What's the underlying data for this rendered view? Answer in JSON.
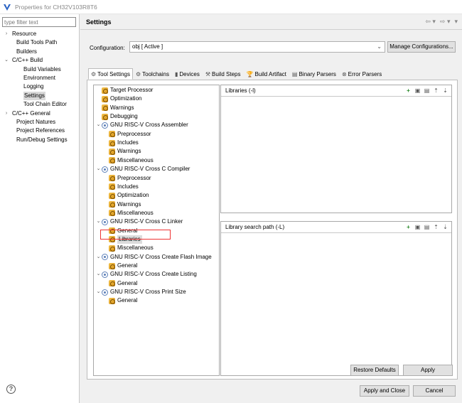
{
  "window": {
    "title": "Properties for CH32V103R8T6"
  },
  "filter": {
    "placeholder": "type filter text"
  },
  "nav": [
    {
      "label": "Resource",
      "indent": 0,
      "arrow": "›"
    },
    {
      "label": "Build Tools Path",
      "indent": 1,
      "arrow": ""
    },
    {
      "label": "Builders",
      "indent": 1,
      "arrow": ""
    },
    {
      "label": "C/C++ Build",
      "indent": 0,
      "arrow": "⌄"
    },
    {
      "label": "Build Variables",
      "indent": 2,
      "arrow": ""
    },
    {
      "label": "Environment",
      "indent": 2,
      "arrow": ""
    },
    {
      "label": "Logging",
      "indent": 2,
      "arrow": ""
    },
    {
      "label": "Settings",
      "indent": 2,
      "arrow": "",
      "selected": true
    },
    {
      "label": "Tool Chain Editor",
      "indent": 2,
      "arrow": ""
    },
    {
      "label": "C/C++ General",
      "indent": 0,
      "arrow": "›"
    },
    {
      "label": "Project Natures",
      "indent": 1,
      "arrow": ""
    },
    {
      "label": "Project References",
      "indent": 1,
      "arrow": ""
    },
    {
      "label": "Run/Debug Settings",
      "indent": 1,
      "arrow": ""
    }
  ],
  "page": {
    "title": "Settings"
  },
  "config": {
    "label": "Configuration:",
    "value": "obj  [ Active ]",
    "manage_label": "Manage Configurations..."
  },
  "tabs": [
    {
      "label": "Tool Settings",
      "icon": "tool-settings-icon",
      "glyph": "⚙",
      "active": true
    },
    {
      "label": "Toolchains",
      "icon": "toolchains-icon",
      "glyph": "⚙"
    },
    {
      "label": "Devices",
      "icon": "devices-icon",
      "glyph": "▮"
    },
    {
      "label": "Build Steps",
      "icon": "build-steps-icon",
      "glyph": "⚒"
    },
    {
      "label": "Build Artifact",
      "icon": "build-artifact-icon",
      "glyph": "🏆"
    },
    {
      "label": "Binary Parsers",
      "icon": "binary-parsers-icon",
      "glyph": "▤"
    },
    {
      "label": "Error Parsers",
      "icon": "error-parsers-icon",
      "glyph": "⊗"
    }
  ],
  "tree": [
    {
      "label": "Target Processor",
      "level": 0,
      "type": "opt"
    },
    {
      "label": "Optimization",
      "level": 0,
      "type": "opt"
    },
    {
      "label": "Warnings",
      "level": 0,
      "type": "opt"
    },
    {
      "label": "Debugging",
      "level": 0,
      "type": "opt"
    },
    {
      "label": "GNU RISC-V Cross Assembler",
      "level": 0,
      "type": "tool"
    },
    {
      "label": "Preprocessor",
      "level": 1,
      "type": "opt"
    },
    {
      "label": "Includes",
      "level": 1,
      "type": "opt"
    },
    {
      "label": "Warnings",
      "level": 1,
      "type": "opt"
    },
    {
      "label": "Miscellaneous",
      "level": 1,
      "type": "opt"
    },
    {
      "label": "GNU RISC-V Cross C Compiler",
      "level": 0,
      "type": "tool"
    },
    {
      "label": "Preprocessor",
      "level": 1,
      "type": "opt"
    },
    {
      "label": "Includes",
      "level": 1,
      "type": "opt"
    },
    {
      "label": "Optimization",
      "level": 1,
      "type": "opt"
    },
    {
      "label": "Warnings",
      "level": 1,
      "type": "opt"
    },
    {
      "label": "Miscellaneous",
      "level": 1,
      "type": "opt"
    },
    {
      "label": "GNU RISC-V Cross C Linker",
      "level": 0,
      "type": "tool"
    },
    {
      "label": "General",
      "level": 1,
      "type": "opt"
    },
    {
      "label": "Libraries",
      "level": 1,
      "type": "opt",
      "selected": true
    },
    {
      "label": "Miscellaneous",
      "level": 1,
      "type": "opt"
    },
    {
      "label": "GNU RISC-V Cross Create Flash Image",
      "level": 0,
      "type": "tool"
    },
    {
      "label": "General",
      "level": 1,
      "type": "opt"
    },
    {
      "label": "GNU RISC-V Cross Create Listing",
      "level": 0,
      "type": "tool"
    },
    {
      "label": "General",
      "level": 1,
      "type": "opt"
    },
    {
      "label": "GNU RISC-V Cross Print Size",
      "level": 0,
      "type": "tool"
    },
    {
      "label": "General",
      "level": 1,
      "type": "opt"
    }
  ],
  "libraries": {
    "title": "Libraries (-l)"
  },
  "libpaths": {
    "title": "Library search path (-L)"
  },
  "list_tools": [
    {
      "name": "add-icon",
      "glyph": "+"
    },
    {
      "name": "add-workspace-icon",
      "glyph": "▣"
    },
    {
      "name": "delete-icon",
      "glyph": "▤"
    },
    {
      "name": "move-up-icon",
      "glyph": "⇡"
    },
    {
      "name": "move-down-icon",
      "glyph": "⇣"
    }
  ],
  "buttons": {
    "restore": "Restore Defaults",
    "apply": "Apply",
    "apply_close": "Apply and Close",
    "cancel": "Cancel"
  }
}
